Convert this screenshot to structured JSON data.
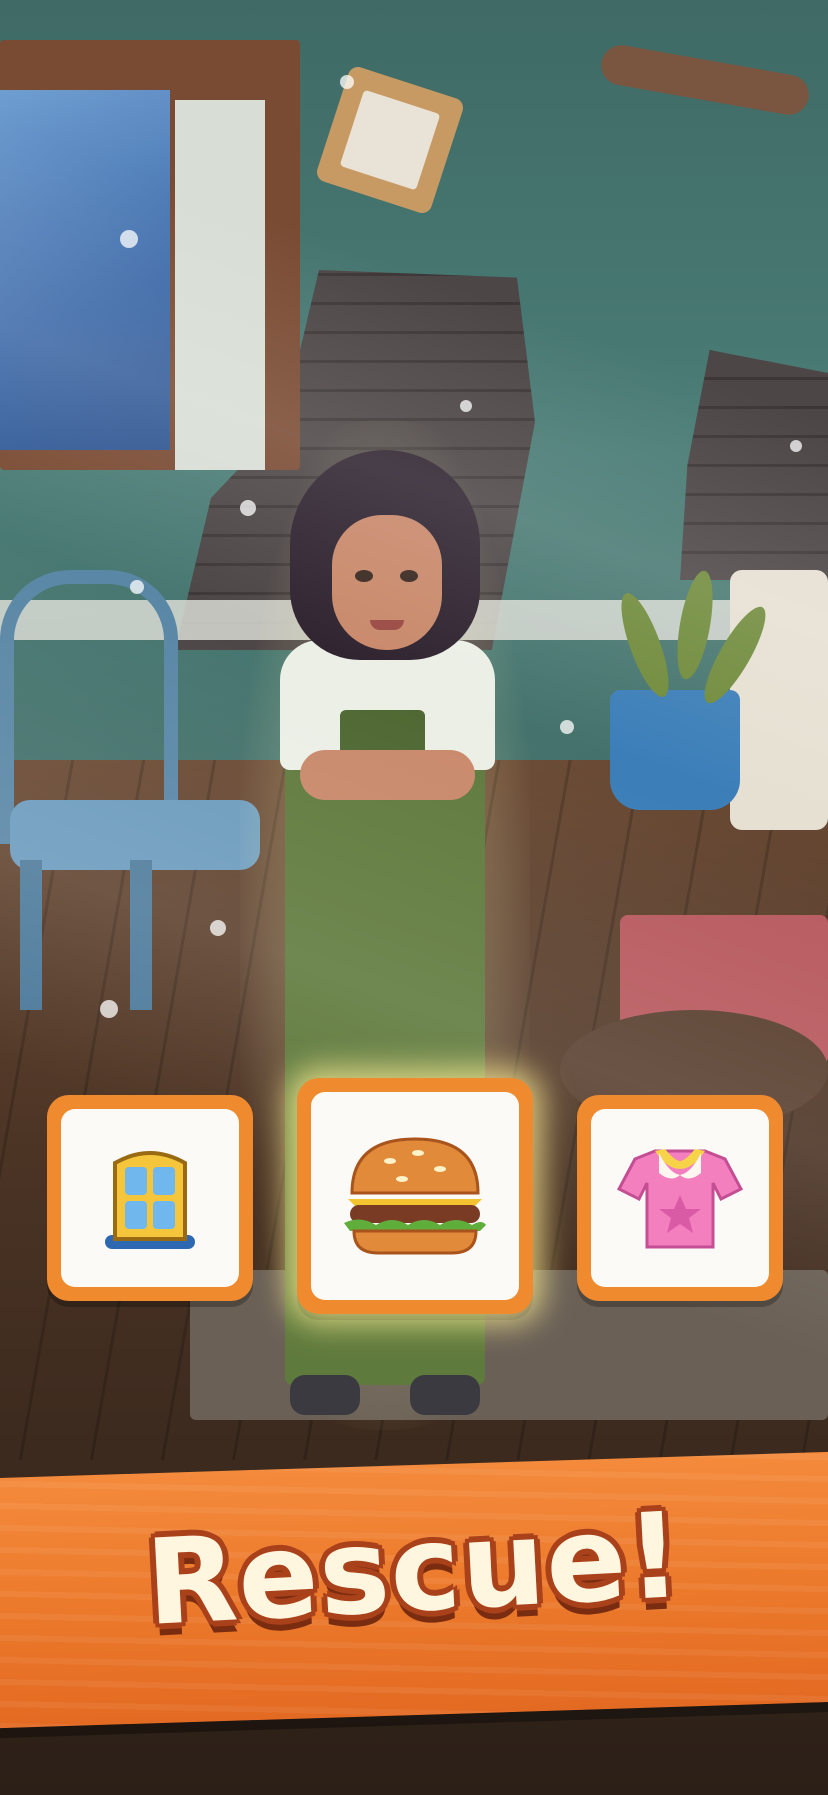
{
  "banner": {
    "text": "Rescue!"
  },
  "choices": [
    {
      "item": "window",
      "icon": "window-icon",
      "highlighted": false
    },
    {
      "item": "burger",
      "icon": "burger-icon",
      "highlighted": true
    },
    {
      "item": "shirt",
      "icon": "pink-shirt-icon",
      "highlighted": false
    }
  ],
  "colors": {
    "card_border": "#ef8a2f",
    "banner": "#ec7a2c",
    "banner_text": "#fff6e0",
    "highlight_glow": "#fff096"
  }
}
